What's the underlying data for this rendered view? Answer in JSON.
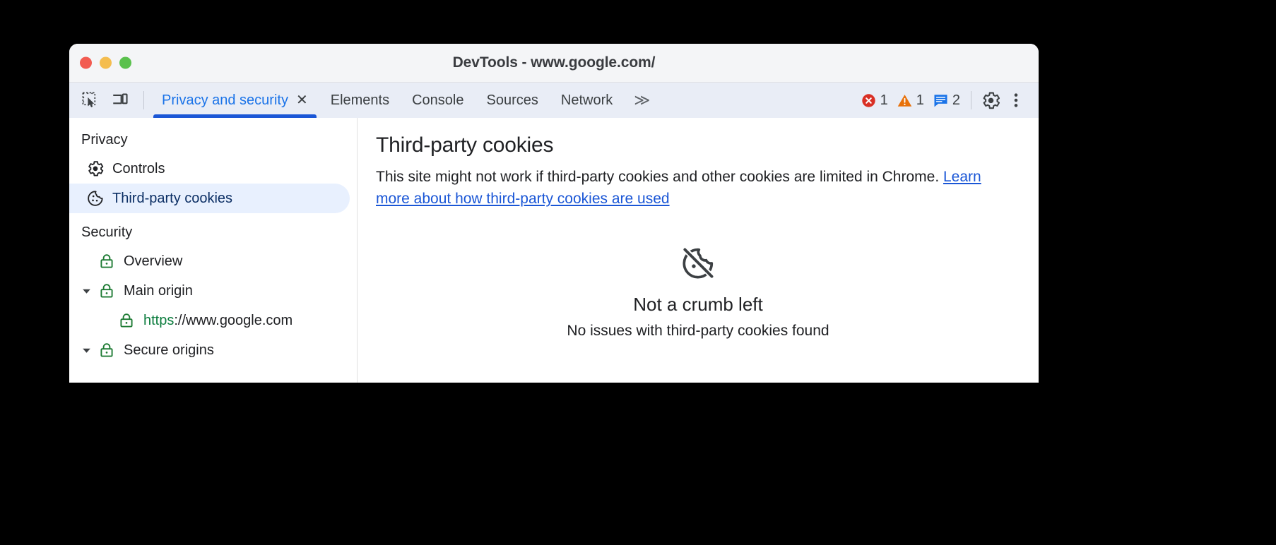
{
  "window": {
    "title": "DevTools - www.google.com/",
    "traffic_lights": [
      {
        "name": "close",
        "color": "#f25b51"
      },
      {
        "name": "minimize",
        "color": "#f4bd4f"
      },
      {
        "name": "maximize",
        "color": "#5ac14d"
      }
    ]
  },
  "toolbar": {
    "inspect_icon": "inspect-element-icon",
    "device_icon": "device-toolbar-icon",
    "tabs": [
      {
        "label": "Privacy and security",
        "active": true,
        "closable": true,
        "close_glyph": "✕"
      },
      {
        "label": "Elements",
        "active": false,
        "closable": false
      },
      {
        "label": "Console",
        "active": false,
        "closable": false
      },
      {
        "label": "Sources",
        "active": false,
        "closable": false
      },
      {
        "label": "Network",
        "active": false,
        "closable": false
      }
    ],
    "more_tabs_glyph": "≫",
    "counters": [
      {
        "name": "errors",
        "value": "1",
        "icon": "error-circle-icon",
        "color": "#d93025"
      },
      {
        "name": "warnings",
        "value": "1",
        "icon": "warning-triangle-icon",
        "color": "#e8710a"
      },
      {
        "name": "messages",
        "value": "2",
        "icon": "message-bubble-icon",
        "color": "#1a73e8"
      }
    ],
    "settings_label": "Settings",
    "more_options_label": "Customize and control DevTools"
  },
  "sidebar": {
    "groups": [
      {
        "header": "Privacy",
        "items": [
          {
            "label": "Controls",
            "icon": "gear-icon",
            "selected": false,
            "indent": false,
            "twisty": false
          },
          {
            "label": "Third-party cookies",
            "icon": "cookie-icon",
            "selected": true,
            "indent": false,
            "twisty": false
          }
        ]
      },
      {
        "header": "Security",
        "items": [
          {
            "label": "Overview",
            "icon": "lock-icon",
            "selected": false,
            "indent": false,
            "twisty": false
          },
          {
            "label": "Main origin",
            "icon": "lock-icon",
            "selected": false,
            "indent": false,
            "twisty": true
          },
          {
            "label": "https://www.google.com",
            "label_scheme": "https",
            "label_rest": "://www.google.com",
            "icon": "lock-icon",
            "selected": false,
            "indent": true,
            "twisty": false
          },
          {
            "label": "Secure origins",
            "icon": "lock-icon",
            "selected": false,
            "indent": false,
            "twisty": true
          }
        ]
      }
    ]
  },
  "main": {
    "title": "Third-party cookies",
    "description_part1": "This site might not work if third-party cookies and other cookies are limited in Chrome. ",
    "description_link": "Learn more about how third-party cookies are used",
    "empty_state": {
      "icon": "cookie-off-icon",
      "title": "Not a crumb left",
      "subtitle": "No issues with third-party cookies found"
    }
  },
  "colors": {
    "accent_blue": "#1a73e8",
    "tab_underline": "#1a56d6",
    "toolbar_bg": "#e9edf6",
    "titlebar_bg": "#f4f5f7",
    "selected_row_bg": "#e8f0fe",
    "lock_green": "#1e7b34",
    "link_blue": "#1a56d6"
  }
}
